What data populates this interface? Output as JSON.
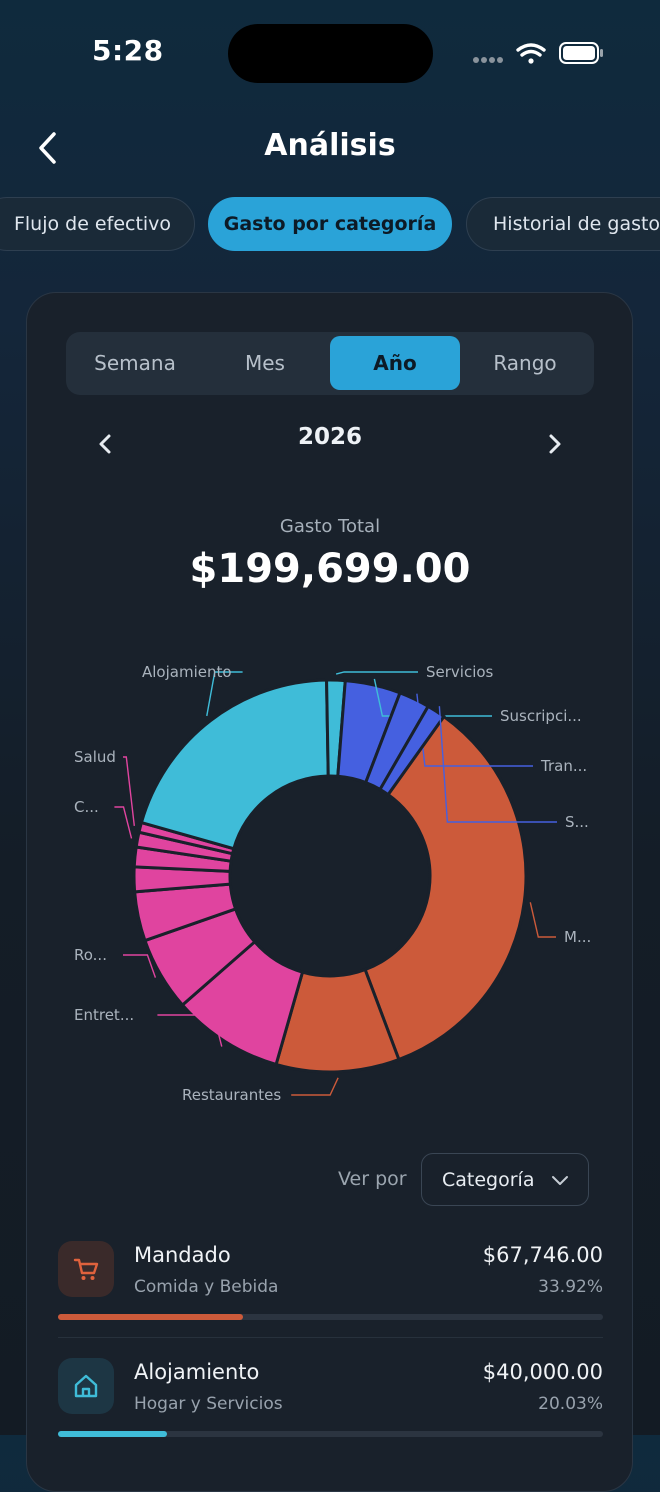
{
  "status": {
    "time": "5:28"
  },
  "header": {
    "title": "Análisis"
  },
  "tabs": [
    {
      "label": "Flujo de efectivo",
      "active": false
    },
    {
      "label": "Gasto por categoría",
      "active": true
    },
    {
      "label": "Historial de gastos",
      "active": false
    }
  ],
  "period": {
    "options": [
      "Semana",
      "Mes",
      "Año",
      "Rango"
    ],
    "selected": "Año",
    "current": "2026"
  },
  "summary": {
    "label": "Gasto Total",
    "value": "$199,699.00"
  },
  "chart_data": {
    "type": "pie",
    "subtype": "donut",
    "slices": [
      {
        "label": "M...",
        "value": 33.92,
        "color": "#cc5a3a"
      },
      {
        "label": "Restaurantes",
        "value": 10.0,
        "color": "#cc5a3a"
      },
      {
        "label": "Entret...",
        "value": 9.0,
        "color": "#e0449f"
      },
      {
        "label": "Ro...",
        "value": 6.0,
        "color": "#e0449f"
      },
      {
        "label": "",
        "value": 4.0,
        "color": "#e0449f"
      },
      {
        "label": "",
        "value": 2.0,
        "color": "#e0449f"
      },
      {
        "label": "",
        "value": 1.6,
        "color": "#e0449f"
      },
      {
        "label": "C...",
        "value": 1.2,
        "color": "#e0449f"
      },
      {
        "label": "Salud",
        "value": 0.8,
        "color": "#e0449f"
      },
      {
        "label": "Alojamiento",
        "value": 20.03,
        "color": "#3fbcd8"
      },
      {
        "label": "Servicios",
        "value": 1.5,
        "color": "#3fbcd8"
      },
      {
        "label": "Suscripci...",
        "value": 4.5,
        "color": "#4560e0"
      },
      {
        "label": "Tran...",
        "value": 2.5,
        "color": "#4560e0"
      },
      {
        "label": "S...",
        "value": 1.5,
        "color": "#4560e0"
      }
    ]
  },
  "filter": {
    "label": "Ver por",
    "value": "Categoría"
  },
  "categories": [
    {
      "name": "Mandado",
      "group": "Comida y Bebida",
      "amount": "$67,746.00",
      "percent": "33.92%",
      "fraction": 0.3392,
      "color": "#cc5a3a",
      "icon": "cart-icon"
    },
    {
      "name": "Alojamiento",
      "group": "Hogar y Servicios",
      "amount": "$40,000.00",
      "percent": "20.03%",
      "fraction": 0.2003,
      "color": "#3fbcd8",
      "icon": "home-icon"
    }
  ]
}
